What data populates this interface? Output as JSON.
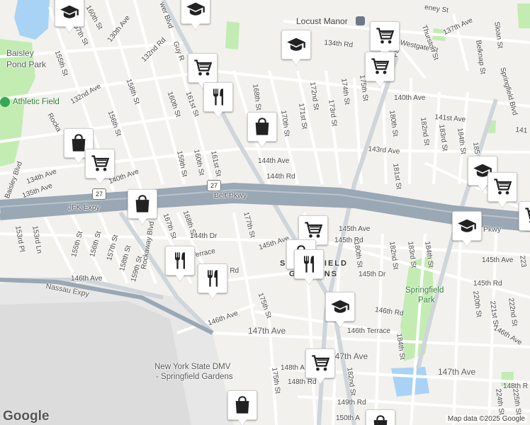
{
  "map": {
    "provider_logo": "Google",
    "copyright": "Map data ©2025 Google",
    "pois": {
      "locust_manor": "Locust Manor",
      "dmv_line1": "New York State DMV",
      "dmv_line2": "- Springfield Gardens",
      "baisley_line1": "Baisley",
      "baisley_line2": "Pond Park",
      "athletic_field": "Athletic Field",
      "springfield_line1": "Springfield",
      "springfield_line2": "Park",
      "neighborhood_line1": "SPRINGFIELD",
      "neighborhood_line2": "GARDENS"
    },
    "highways": {
      "belt": "Belt Pkwy",
      "jfk": "JFK Expy",
      "nassau": "Nassau Expy",
      "route_shield": "27",
      "belt_right": "Pkwy"
    },
    "streets": {
      "s160_top": "160th St",
      "s157_top": "157th St",
      "a130": "130th Ave",
      "r132": "132nd Rd",
      "blvd_top": "wer Blvd",
      "guy": "Guy R",
      "s155": "155th St",
      "a132": "132nd Ave",
      "s158": "158th St",
      "s160b": "160th St",
      "s161": "161st St",
      "s156": "156th St",
      "rock": "Rocka",
      "baisley_blvd": "Baisley Blvd",
      "a134": "134th Ave",
      "a135": "135th Ave",
      "a140w": "140th Ave",
      "s159": "159th St",
      "s160c": "160th St",
      "s161c": "161st St",
      "s168": "168th St",
      "s170": "170th St",
      "s171": "171st St",
      "s172": "172nd St",
      "s173": "173rd St",
      "s174": "174th St",
      "s175": "175th St",
      "r134": "134th Rd",
      "westgate": "Westgate St",
      "thurston": "Thurston St",
      "a137": "137th Ave",
      "belknap": "Belknap St",
      "sloan": "Sloan St",
      "springfield_blvd": "Springfield Blvd",
      "cheney": "eney St",
      "farm": "Farm",
      "a140e": "140th Ave",
      "a141": "141st Ave",
      "a143": "143rd Ave",
      "s180": "180th St",
      "s181": "181st St",
      "s182": "182nd St",
      "s183": "183rd St",
      "s184": "184th St",
      "s185": "185",
      "a141r": "141",
      "a144": "144th Ave",
      "r144": "144th Rd",
      "s153": "153rd Pl",
      "ln153": "153rd Ln",
      "s155b": "155th St",
      "s156b": "156th St",
      "s157b": "157th St",
      "s158b": "158th St",
      "s159b": "159th St",
      "rockaway": "Rockaway Blvd",
      "s167": "167th St",
      "s168b": "168th St",
      "dr144": "144th Dr",
      "terrace": "Terrace",
      "rd145_mid": "h Rd",
      "a146w": "146th Ave",
      "s177": "177th St",
      "a145": "145th Ave",
      "a145e": "145th Ave",
      "rd145": "145th Rd",
      "s180b": "180th St",
      "dr145": "145th Dr",
      "s182b": "182nd St",
      "s183b": "183rd St",
      "s184b": "184th St",
      "a145r": "145th Ave",
      "rd145r": "145th Rd",
      "s220": "220th St",
      "s221": "221st St",
      "s222": "222nd St",
      "s223": "223",
      "a146r": "146th Ave",
      "rd146": "146th Rd",
      "t146": "146th Terrace",
      "a146w2": "146th Ave",
      "s175b": "175th St",
      "a147": "147th Ave",
      "a147m": "147th Ave",
      "a147r": "147th Ave",
      "a148": "148th A",
      "r148": "148th Rd",
      "s182c": "182nd St",
      "s184c": "184th St",
      "s175c": "175th St",
      "r149": "149th Rd",
      "a150": "150th A",
      "r148r": "148th R",
      "s224": "224th St",
      "s225": "225th St",
      "a146x": "146th Ave"
    },
    "pins": [
      {
        "kind": "school-icon"
      },
      {
        "kind": "school-icon"
      },
      {
        "kind": "school-icon"
      },
      {
        "kind": "grocery-cart-icon"
      },
      {
        "kind": "grocery-cart-icon"
      },
      {
        "kind": "grocery-cart-icon"
      },
      {
        "kind": "restaurant-icon"
      },
      {
        "kind": "shopping-bag-icon"
      },
      {
        "kind": "shopping-bag-icon"
      },
      {
        "kind": "grocery-cart-icon"
      },
      {
        "kind": "shopping-bag-icon"
      },
      {
        "kind": "school-icon"
      },
      {
        "kind": "grocery-cart-icon"
      },
      {
        "kind": "school-icon"
      },
      {
        "kind": "grocery-cart-icon"
      },
      {
        "kind": "restaurant-icon"
      },
      {
        "kind": "restaurant-icon"
      },
      {
        "kind": "grocery-cart-icon"
      },
      {
        "kind": "shopping-bag-icon"
      },
      {
        "kind": "restaurant-icon"
      },
      {
        "kind": "school-icon"
      },
      {
        "kind": "grocery-cart-icon"
      },
      {
        "kind": "shopping-bag-icon"
      },
      {
        "kind": "shopping-bag-icon"
      }
    ],
    "colors": {
      "water": "#a9d3f5",
      "park": "#c3ecb2",
      "highway": "#9aa7b4",
      "road": "#ffffff",
      "airport": "#e4e4e4"
    }
  }
}
